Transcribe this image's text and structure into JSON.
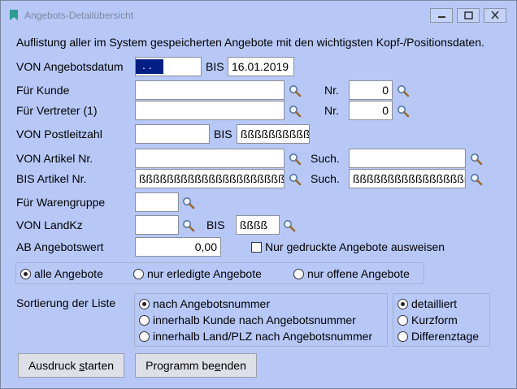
{
  "window": {
    "title": "Angebots-Detailübersicht"
  },
  "intro": "Auflistung aller im System gespeicherten Angebote mit den wichtigsten Kopf-/Positionsdaten.",
  "fields": {
    "von_datum_label": "VON Angebotsdatum",
    "von_datum_value": ". .",
    "bis_label": "BIS",
    "bis_datum_value": "16.01.2019",
    "kunde_label": "Für Kunde",
    "kunde_value": "",
    "nr_label": "Nr.",
    "kunde_nr_value": "0",
    "vertreter_label": "Für Vertreter (1)",
    "vertreter_value": "",
    "vertreter_nr_value": "0",
    "plz_label": "VON Postleitzahl",
    "plz_von_value": "",
    "plz_bis_value": "ßßßßßßßßßß",
    "von_artikel_label": "VON Artikel Nr.",
    "von_artikel_value": "",
    "such_label": "Such.",
    "von_such_value": "",
    "bis_artikel_label": "BIS Artikel Nr.",
    "bis_artikel_value": "ßßßßßßßßßßßßßßßßßßßßßßßßß",
    "bis_such_value": "ßßßßßßßßßßßßßßßßßß",
    "warengruppe_label": "Für Warengruppe",
    "warengruppe_value": "",
    "landkz_label": "VON LandKz",
    "landkz_von_value": "",
    "landkz_bis_value": "ßßßß",
    "angebotswert_label": "AB Angebotswert",
    "angebotswert_value": "0,00",
    "nur_gedruckte_label": "Nur gedruckte Angebote ausweisen"
  },
  "filter_radios": [
    {
      "label": "alle Angebote",
      "selected": true
    },
    {
      "label": "nur erledigte Angebote",
      "selected": false
    },
    {
      "label": "nur offene Angebote",
      "selected": false
    }
  ],
  "sort": {
    "label": "Sortierung der Liste",
    "options": [
      {
        "label": "nach Angebotsnummer",
        "selected": true
      },
      {
        "label": "innerhalb Kunde nach Angebotsnummer",
        "selected": false
      },
      {
        "label": "innerhalb Land/PLZ nach Angebotsnummer",
        "selected": false
      }
    ],
    "detail_options": [
      {
        "label": "detailliert",
        "selected": true
      },
      {
        "label": "Kurzform",
        "selected": false
      },
      {
        "label": "Differenztage",
        "selected": false
      }
    ]
  },
  "buttons": {
    "print_pre": "Ausdruck ",
    "print_ul": "s",
    "print_post": "tarten",
    "end_pre": "Programm be",
    "end_ul": "e",
    "end_post": "nden"
  },
  "colors": {
    "background": "#b7c8f7",
    "selection": "#001e84"
  }
}
